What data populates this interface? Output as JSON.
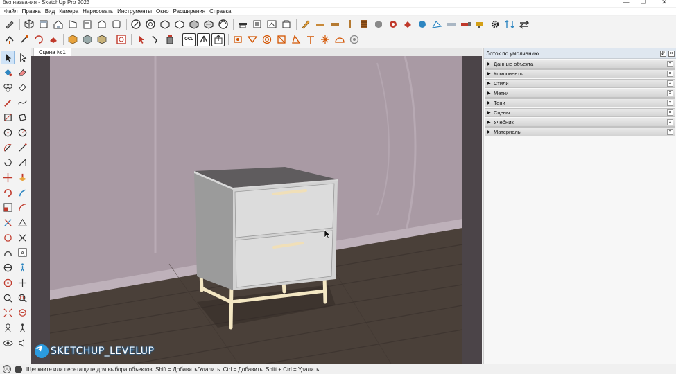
{
  "window": {
    "title": "без названия - SketchUp Pro 2023",
    "controls": {
      "minimize": "—",
      "maximize": "❐",
      "close": "✕"
    }
  },
  "menu": [
    "Файл",
    "Правка",
    "Вид",
    "Камера",
    "Нарисовать",
    "Инструменты",
    "Окно",
    "Расширения",
    "Справка"
  ],
  "scene": {
    "tab_label": "Сцена №1"
  },
  "tray": {
    "title": "Лоток по умолчанию",
    "panels": [
      "Данные объекта",
      "Компоненты",
      "Стили",
      "Метки",
      "Тени",
      "Сцены",
      "Учебник",
      "Материалы"
    ],
    "close_glyph": "×",
    "arrow_glyph": "▶",
    "pin_glyph": "⇵",
    "header_close_glyph": "×"
  },
  "toolbar_top": {
    "icons": [
      "large-tool-set-icon",
      "iso-view-icon",
      "top-view-icon",
      "front-view-icon",
      "right-view-icon",
      "back-view-icon",
      "left-view-icon",
      "bottom-view-icon",
      "xray-icon",
      "back-edges-icon",
      "wireframe-icon",
      "hidden-line-icon",
      "shaded-icon",
      "shaded-textures-icon",
      "monochrome-icon",
      "section-plane-icon",
      "section-cut-icon",
      "section-fill-icon",
      "display-sections-icon",
      "pencil-icon",
      "ruler-icon",
      "board-icon",
      "plank-icon",
      "stack-icon",
      "cube-icon",
      "paint-icon",
      "tag-icon",
      "sphere-icon",
      "sandbox-icon",
      "saw-icon",
      "drill-icon",
      "settings-icon",
      "arrows-icon",
      "swap-icon"
    ]
  },
  "toolbar_second": {
    "icons": [
      "push-pull-icon",
      "rotate-icon",
      "move-icon",
      "erase-icon",
      "box-icon",
      "component-icon",
      "component-alt-icon",
      "outliner-icon",
      "select-icon",
      "lasso-icon",
      "paint-bucket-icon",
      "ocl-icon",
      "tree-icon",
      "export-icon",
      "lamp-icon",
      "spot-icon",
      "ring-icon",
      "sun-icon",
      "cone-icon",
      "pillar-icon",
      "burst-icon",
      "dome-icon",
      "gear-icon"
    ],
    "ocl_label": "OCL"
  },
  "left_tools": [
    "select-icon",
    "select-alt-icon",
    "paint-bucket-icon",
    "eraser-icon",
    "component-tool-icon",
    "tag-tool-icon",
    "pencil-line-icon",
    "freehand-icon",
    "rectangle-icon",
    "rotated-rect-icon",
    "circle-icon",
    "polygon-icon",
    "arc-icon",
    "arc-3pt-icon",
    "pie-icon",
    "pie-alt-icon",
    "move-tool-icon",
    "push-pull-tool-icon",
    "rotate-tool-icon",
    "follow-me-icon",
    "scale-icon",
    "offset-icon",
    "tape-icon",
    "protractor-icon",
    "dimension-icon",
    "axes-icon",
    "text-icon",
    "3d-text-icon",
    "section-tool-icon",
    "walk-icon",
    "orbit-icon",
    "pan-icon",
    "zoom-icon",
    "zoom-window-icon",
    "zoom-extents-icon",
    "previous-view-icon",
    "position-camera-icon",
    "look-around-icon",
    "eye-icon",
    "sound-icon"
  ],
  "watermark": {
    "text": "SKETCHUP_LEVELUP"
  },
  "statusbar": {
    "text": "Щелкните или перетащите для выбора объектов. Shift = Добавить/Удалить. Ctrl = Добавить. Shift + Ctrl = Удалить.",
    "info_glyph": "ⓘ"
  },
  "colors": {
    "wall": "#a99aa4",
    "floor": "#4a4039",
    "nightstand": "#cfcfcf",
    "legs": "#f4e7c3",
    "tray_header": "#dfe7f0"
  }
}
